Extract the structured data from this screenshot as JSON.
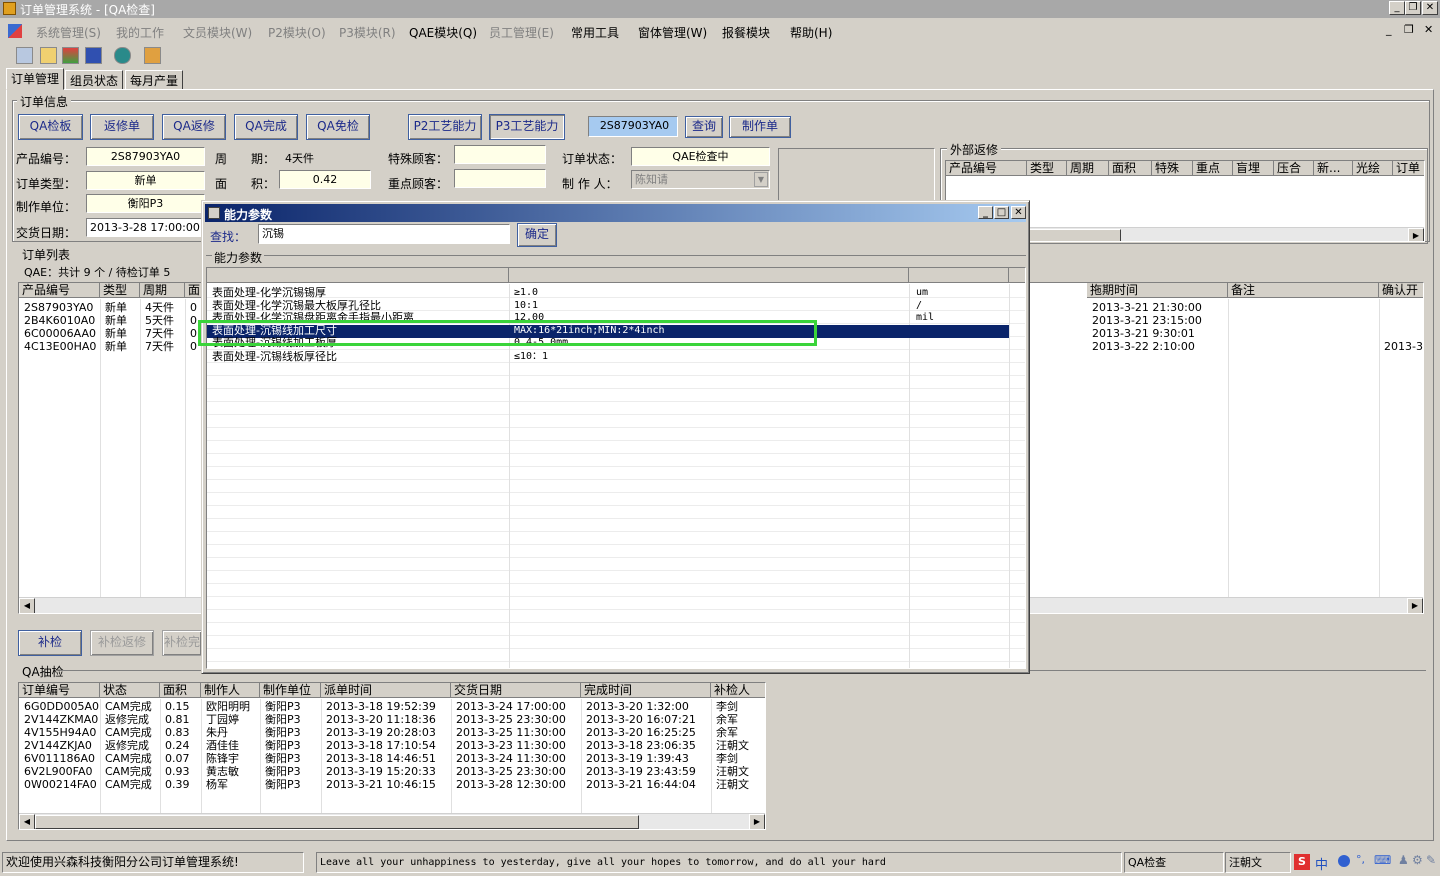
{
  "window": {
    "title": "订单管理系统 - [QA检查]"
  },
  "menu": [
    {
      "label": "系统管理(S)",
      "disabled": true
    },
    {
      "label": "我的工作",
      "disabled": true
    },
    {
      "label": "文员模块(W)",
      "disabled": true
    },
    {
      "label": "P2模块(O)",
      "disabled": true
    },
    {
      "label": "P3模块(R)",
      "disabled": true
    },
    {
      "label": "QAE模块(Q)",
      "disabled": false
    },
    {
      "label": "员工管理(E)",
      "disabled": true
    },
    {
      "label": "常用工具",
      "disabled": false
    },
    {
      "label": "窗体管理(W)",
      "disabled": false
    },
    {
      "label": "报餐模块",
      "disabled": false
    },
    {
      "label": "帮助(H)",
      "disabled": false
    }
  ],
  "tabs": [
    "订单管理",
    "组员状态",
    "每月产量"
  ],
  "order_info": {
    "title": "订单信息",
    "buttons": [
      "QA检板",
      "返修单",
      "QA返修",
      "QA完成",
      "QA免检",
      "P2工艺能力",
      "P3工艺能力",
      "查询",
      "制作单"
    ],
    "search_value": "2S87903YA0",
    "labels": {
      "product_no": "产品编号：",
      "cycle": "周　　期：",
      "special": "特殊顾客：",
      "order_status": "订单状态：",
      "order_type": "订单类型：",
      "area": "面　　积：",
      "key": "重点顾客：",
      "maker": "制 作 人：",
      "unit": "制作单位：",
      "delivery": "交货日期："
    },
    "values": {
      "product_no": "2S87903YA0",
      "cycle": "4天件",
      "order_status": "QAE检查中",
      "order_type": "新单",
      "area": "0.42",
      "maker": "陈知请",
      "unit": "衡阳P3",
      "delivery": "2013-3-28 17:00:00"
    }
  },
  "external_rework": {
    "title": "外部返修",
    "columns": [
      "产品编号",
      "类型",
      "周期",
      "面积",
      "特殊",
      "重点",
      "盲埋",
      "压合",
      "新...",
      "光绘",
      "订单"
    ]
  },
  "order_list": {
    "title": "订单列表",
    "summary": "QAE：共计 9 个 / 待检订单 5",
    "columns_left": [
      "产品编号",
      "类型",
      "周期",
      "面"
    ],
    "columns_right": [
      "拖期时间",
      "备注",
      "确认开"
    ],
    "rows": [
      {
        "code": "2S87903YA0",
        "type": "新单",
        "cycle": "4天件",
        "area": "0",
        "delay": "2013-3-21 21:30:00",
        "note": "",
        "confirm": ""
      },
      {
        "code": "2B4K6010A0",
        "type": "新单",
        "cycle": "5天件",
        "area": "0",
        "delay": "2013-3-21 23:15:00",
        "note": "",
        "confirm": ""
      },
      {
        "code": "6C00006AA0",
        "type": "新单",
        "cycle": "7天件",
        "area": "0",
        "delay": "2013-3-21 9:30:01",
        "note": "",
        "confirm": ""
      },
      {
        "code": "4C13E00HA0",
        "type": "新单",
        "cycle": "7天件",
        "area": "0",
        "delay": "2013-3-22 2:10:00",
        "note": "",
        "confirm": "2013-3-"
      }
    ]
  },
  "recheck_buttons": [
    "补检",
    "补检返修",
    "补检完"
  ],
  "qa_sample": {
    "title": "QA抽检",
    "columns": [
      "订单编号",
      "状态",
      "面积",
      "制作人",
      "制作单位",
      "派单时间",
      "交货日期",
      "完成时间",
      "补检人"
    ],
    "rows": [
      [
        "6G0DD005A0",
        "CAM完成",
        "0.15",
        "欧阳明明",
        "衡阳P3",
        "2013-3-18 19:52:39",
        "2013-3-24 17:00:00",
        "2013-3-20 1:32:00",
        "李剑"
      ],
      [
        "2V144ZKMA0",
        "返修完成",
        "0.81",
        "丁园婷",
        "衡阳P3",
        "2013-3-20 11:18:36",
        "2013-3-25 23:30:00",
        "2013-3-20 16:07:21",
        "余军"
      ],
      [
        "4V155H94A0",
        "CAM完成",
        "0.83",
        "朱丹",
        "衡阳P3",
        "2013-3-19 20:28:03",
        "2013-3-25 11:30:00",
        "2013-3-20 16:25:25",
        "余军"
      ],
      [
        "2V144ZKJA0",
        "返修完成",
        "0.24",
        "酒佳佳",
        "衡阳P3",
        "2013-3-18 17:10:54",
        "2013-3-23 11:30:00",
        "2013-3-18 23:06:35",
        "汪朝文"
      ],
      [
        "6V011186A0",
        "CAM完成",
        "0.07",
        "陈锋宇",
        "衡阳P3",
        "2013-3-18 14:46:51",
        "2013-3-24 11:30:00",
        "2013-3-19 1:39:43",
        "李剑"
      ],
      [
        "6V2L900FA0",
        "CAM完成",
        "0.93",
        "黄志敏",
        "衡阳P3",
        "2013-3-19 15:20:33",
        "2013-3-25 23:30:00",
        "2013-3-19 23:43:59",
        "汪朝文"
      ],
      [
        "0W00214FA0",
        "CAM完成",
        "0.39",
        "杨军",
        "衡阳P3",
        "2013-3-21 10:46:15",
        "2013-3-28 12:30:00",
        "2013-3-21 16:44:04",
        "汪朝文"
      ]
    ]
  },
  "dialog": {
    "title": "能力参数",
    "search_label": "查找：",
    "search_value": "沉锡",
    "ok_label": "确定",
    "group_title": "能力参数",
    "rows": [
      {
        "name": "表面处理-化学沉锡锡厚",
        "value": "≥1.0",
        "unit": "um"
      },
      {
        "name": "表面处理-化学沉锡最大板厚孔径比",
        "value": "10:1",
        "unit": "/"
      },
      {
        "name": "表面处理-化学沉锡盘距离金手指最小距离",
        "value": "12.00",
        "unit": "mil"
      },
      {
        "name": "表面处理-沉锡线加工尺寸",
        "value": "MAX:16*21inch;MIN:2*4inch",
        "unit": ""
      },
      {
        "name": "表面处理-沉锡线加工板厚",
        "value": "0.4-5.0mm",
        "unit": ""
      },
      {
        "name": "表面处理-沉锡线板厚径比",
        "value": "≤10：1",
        "unit": ""
      }
    ],
    "selected_index": 3
  },
  "status_bar": {
    "welcome": "欢迎使用兴森科技衡阳分公司订单管理系统!",
    "motto": "Leave all your unhappiness to yesterday, give all your hopes to tomorrow, and do all your hard",
    "module": "QA检查",
    "user": "汪朝文",
    "ime": "中"
  },
  "colors": {
    "face": "#d4d0c8",
    "accent_text": "#1c2a8a",
    "title_gradient_start": "#0a246a",
    "selection": "#0a246a",
    "field_bg": "#ffffe8",
    "highlight_box": "#3ad43a"
  }
}
